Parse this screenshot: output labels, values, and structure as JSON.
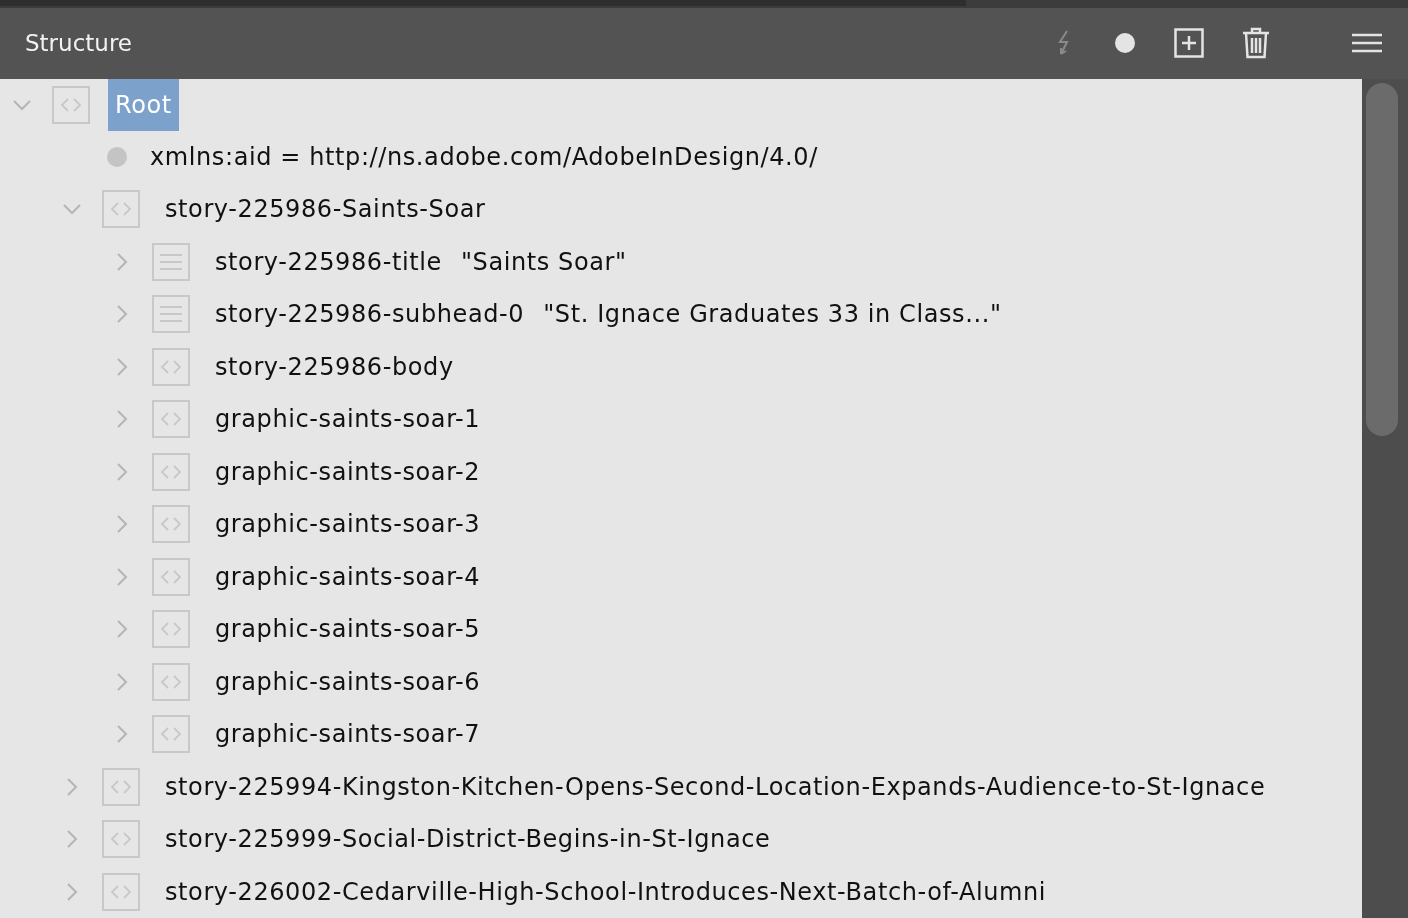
{
  "panel": {
    "title": "Structure"
  },
  "toolbar": [
    {
      "kind": "lightning",
      "disabled": true
    },
    {
      "kind": "circle",
      "disabled": false
    },
    {
      "kind": "add",
      "disabled": false
    },
    {
      "kind": "trash",
      "disabled": false
    },
    {
      "kind": "menu",
      "disabled": false
    }
  ],
  "tree": [
    {
      "kind": "element",
      "label": "Root",
      "selected": true,
      "expanded": true,
      "children": [
        {
          "kind": "attribute",
          "label": "xmlns:aid = http://ns.adobe.com/AdobeInDesign/4.0/",
          "selected": false
        },
        {
          "kind": "element",
          "label": "story-225986-Saints-Soar",
          "selected": false,
          "expanded": true,
          "children": [
            {
              "kind": "text",
              "label": "story-225986-title",
              "content": "\"Saints Soar\"",
              "selected": false,
              "expanded": false
            },
            {
              "kind": "text",
              "label": "story-225986-subhead-0",
              "content": "\"St. Ignace Graduates 33 in Class...\"",
              "selected": false,
              "expanded": false
            },
            {
              "kind": "element",
              "label": "story-225986-body",
              "selected": false,
              "expanded": false
            },
            {
              "kind": "element",
              "label": "graphic-saints-soar-1",
              "selected": false,
              "expanded": false
            },
            {
              "kind": "element",
              "label": "graphic-saints-soar-2",
              "selected": false,
              "expanded": false
            },
            {
              "kind": "element",
              "label": "graphic-saints-soar-3",
              "selected": false,
              "expanded": false
            },
            {
              "kind": "element",
              "label": "graphic-saints-soar-4",
              "selected": false,
              "expanded": false
            },
            {
              "kind": "element",
              "label": "graphic-saints-soar-5",
              "selected": false,
              "expanded": false
            },
            {
              "kind": "element",
              "label": "graphic-saints-soar-6",
              "selected": false,
              "expanded": false
            },
            {
              "kind": "element",
              "label": "graphic-saints-soar-7",
              "selected": false,
              "expanded": false
            }
          ]
        },
        {
          "kind": "element",
          "label": "story-225994-Kingston-Kitchen-Opens-Second-Location-Expands-Audience-to-St-Ignace",
          "selected": false,
          "expanded": false
        },
        {
          "kind": "element",
          "label": "story-225999-Social-District-Begins-in-St-Ignace",
          "selected": false,
          "expanded": false
        },
        {
          "kind": "element",
          "label": "story-226002-Cedarville-High-School-Introduces-Next-Batch-of-Alumni",
          "selected": false,
          "expanded": false
        }
      ]
    }
  ]
}
